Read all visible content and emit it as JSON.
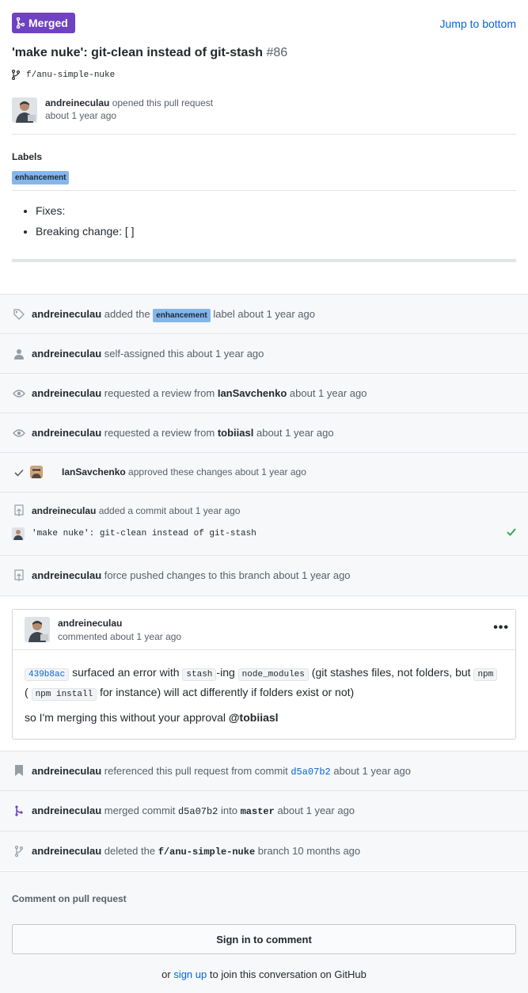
{
  "header": {
    "state_label": "Merged",
    "jump_label": "Jump to bottom",
    "title": "'make nuke': git-clean instead of git-stash",
    "number": "#86",
    "branch": "f/anu-simple-nuke",
    "state_color": "#6f42c1"
  },
  "opener": {
    "user": "andreineculau",
    "action": "opened this pull request",
    "time": "about 1 year ago"
  },
  "labels": {
    "title": "Labels",
    "items": [
      "enhancement"
    ],
    "label_color": "#84b6eb"
  },
  "body": {
    "items": [
      "Fixes:",
      "Breaking change: [ ]"
    ]
  },
  "timeline": {
    "e1": {
      "user": "andreineculau",
      "pre": "added the",
      "label": "enhancement",
      "post": "label about 1 year ago",
      "icon": "tag-icon"
    },
    "e2": {
      "user": "andreineculau",
      "post": "self-assigned this about 1 year ago",
      "icon": "person-icon"
    },
    "e3": {
      "user": "andreineculau",
      "pre": "requested a review from",
      "target": "IanSavchenko",
      "post": "about 1 year ago",
      "icon": "eye-icon"
    },
    "e4": {
      "user": "andreineculau",
      "pre": "requested a review from",
      "target": "tobiiasl",
      "post": "about 1 year ago",
      "icon": "eye-icon"
    },
    "e5": {
      "user": "IanSavchenko",
      "post": "approved these changes about 1 year ago",
      "icon": "check-icon"
    },
    "e6": {
      "user": "andreineculau",
      "post": "added a commit about 1 year ago",
      "commit_message": "'make nuke': git-clean instead of git-stash",
      "icon": "repo-push-icon"
    },
    "e7": {
      "user": "andreineculau",
      "post": "force pushed changes to this branch about 1 year ago",
      "icon": "repo-push-icon"
    },
    "comment": {
      "user": "andreineculau",
      "time": "commented about 1 year ago",
      "sha": "439b8ac",
      "t1": "surfaced an error with",
      "c1": "stash",
      "t2": "-ing",
      "c2": "node_modules",
      "t3": "(git stashes files, not folders, but",
      "c3": "npm",
      "t4": "(",
      "c4": "npm install",
      "t5": "for instance) will act differently if folders exist or not)",
      "p2": "so I'm merging this without your approval",
      "mention": "@tobiiasl"
    },
    "e8": {
      "user": "andreineculau",
      "pre": "referenced this pull request from commit",
      "sha": "d5a07b2",
      "post": "about 1 year ago",
      "icon": "bookmark-icon"
    },
    "e9": {
      "user": "andreineculau",
      "pre": "merged commit",
      "sha": "d5a07b2",
      "mid": "into",
      "target": "master",
      "post": "about 1 year ago",
      "icon": "merge-icon"
    },
    "e10": {
      "user": "andreineculau",
      "pre": "deleted the",
      "target": "f/anu-simple-nuke",
      "post": "branch 10 months ago",
      "icon": "branch-icon"
    }
  },
  "footer": {
    "title": "Comment on pull request",
    "button": "Sign in to comment",
    "join_pre": "or",
    "join_link": "sign up",
    "join_post": "to join this conversation on GitHub"
  }
}
